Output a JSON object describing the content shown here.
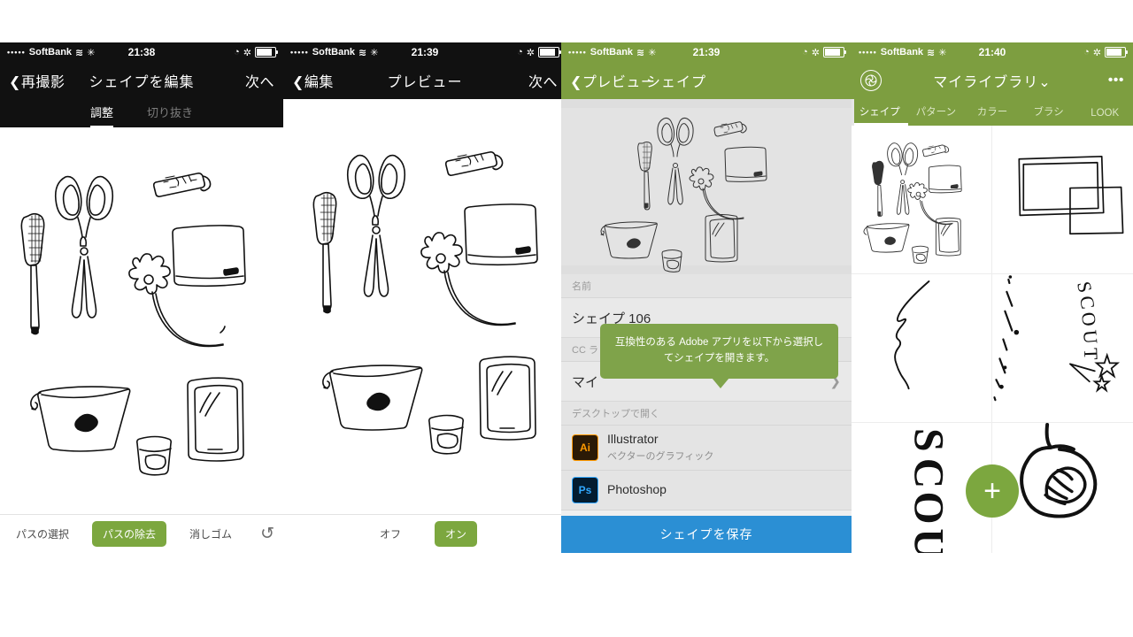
{
  "colors": {
    "green_header": "#7d9e40",
    "green_button": "#7ca73f",
    "blue_save": "#2b8fd4",
    "dark_nav": "#111111",
    "tooltip_green": "#7fa34a"
  },
  "panels": [
    {
      "status": {
        "carrier": "SoftBank",
        "dots": "•••••",
        "wifi": "≋",
        "extra": "✳",
        "time": "21:38",
        "alarm": "◔",
        "bluetooth": "✲"
      },
      "nav": {
        "back": "❮再撮影",
        "title": "シェイプを編集",
        "right": "次へ"
      },
      "subtabs": [
        {
          "label": "調整",
          "active": true
        },
        {
          "label": "切り抜き",
          "active": false
        }
      ],
      "toolbar": [
        {
          "label": "パスの選択",
          "active": false
        },
        {
          "label": "パスの除去",
          "active": true
        },
        {
          "label": "消しゴム",
          "active": false
        }
      ],
      "undo_icon": "↺"
    },
    {
      "status": {
        "carrier": "SoftBank",
        "dots": "•••••",
        "wifi": "≋",
        "extra": "✳",
        "time": "21:39",
        "alarm": "◔",
        "bluetooth": "✲"
      },
      "nav": {
        "back": "❮編集",
        "title": "プレビュー",
        "right": "次へ"
      },
      "toolbar": [
        {
          "label": "オフ",
          "active": false
        },
        {
          "label": "オン",
          "active": true
        }
      ]
    },
    {
      "status": {
        "carrier": "SoftBank",
        "dots": "•••••",
        "wifi": "≋",
        "extra": "✳",
        "time": "21:39",
        "alarm": "◔",
        "bluetooth": "✲"
      },
      "nav": {
        "back": "❮プレビュー",
        "title": "シェイプ",
        "right": ""
      },
      "name_label": "名前",
      "name_value": "シェイプ 106",
      "library_label": "CC ラ",
      "library_value": "マイ",
      "library_chevron": "❯",
      "desktop_label": "デスクトップで開く",
      "apps": [
        {
          "icon": "Ai",
          "name": "Illustrator",
          "desc": "ベクターのグラフィック"
        },
        {
          "icon": "Ps",
          "name": "Photoshop",
          "desc": ""
        }
      ],
      "tooltip": "互換性のある Adobe アプリを以下から選択してシェイプを開きます。",
      "save_label": "シェイプを保存"
    },
    {
      "status": {
        "carrier": "SoftBank",
        "dots": "•••••",
        "wifi": "≋",
        "extra": "✳",
        "time": "21:40",
        "alarm": "◔",
        "bluetooth": "✲"
      },
      "nav": {
        "logo": "shape-logo-icon",
        "title": "マイライブラリ⌄",
        "right": "•••"
      },
      "tabs": [
        {
          "label": "シェイプ",
          "active": true
        },
        {
          "label": "パターン",
          "active": false
        },
        {
          "label": "カラー",
          "active": false
        },
        {
          "label": "ブラシ",
          "active": false
        },
        {
          "label": "LOOK",
          "active": false
        }
      ],
      "grid_items": [
        {
          "name": "sketch-objects"
        },
        {
          "name": "nested-frames"
        },
        {
          "name": "squiggle-curve"
        },
        {
          "name": "scout-dashes-stars"
        },
        {
          "name": "scout-vertical"
        },
        {
          "name": "cupcake-bubble"
        }
      ],
      "fab_label": "+"
    }
  ]
}
